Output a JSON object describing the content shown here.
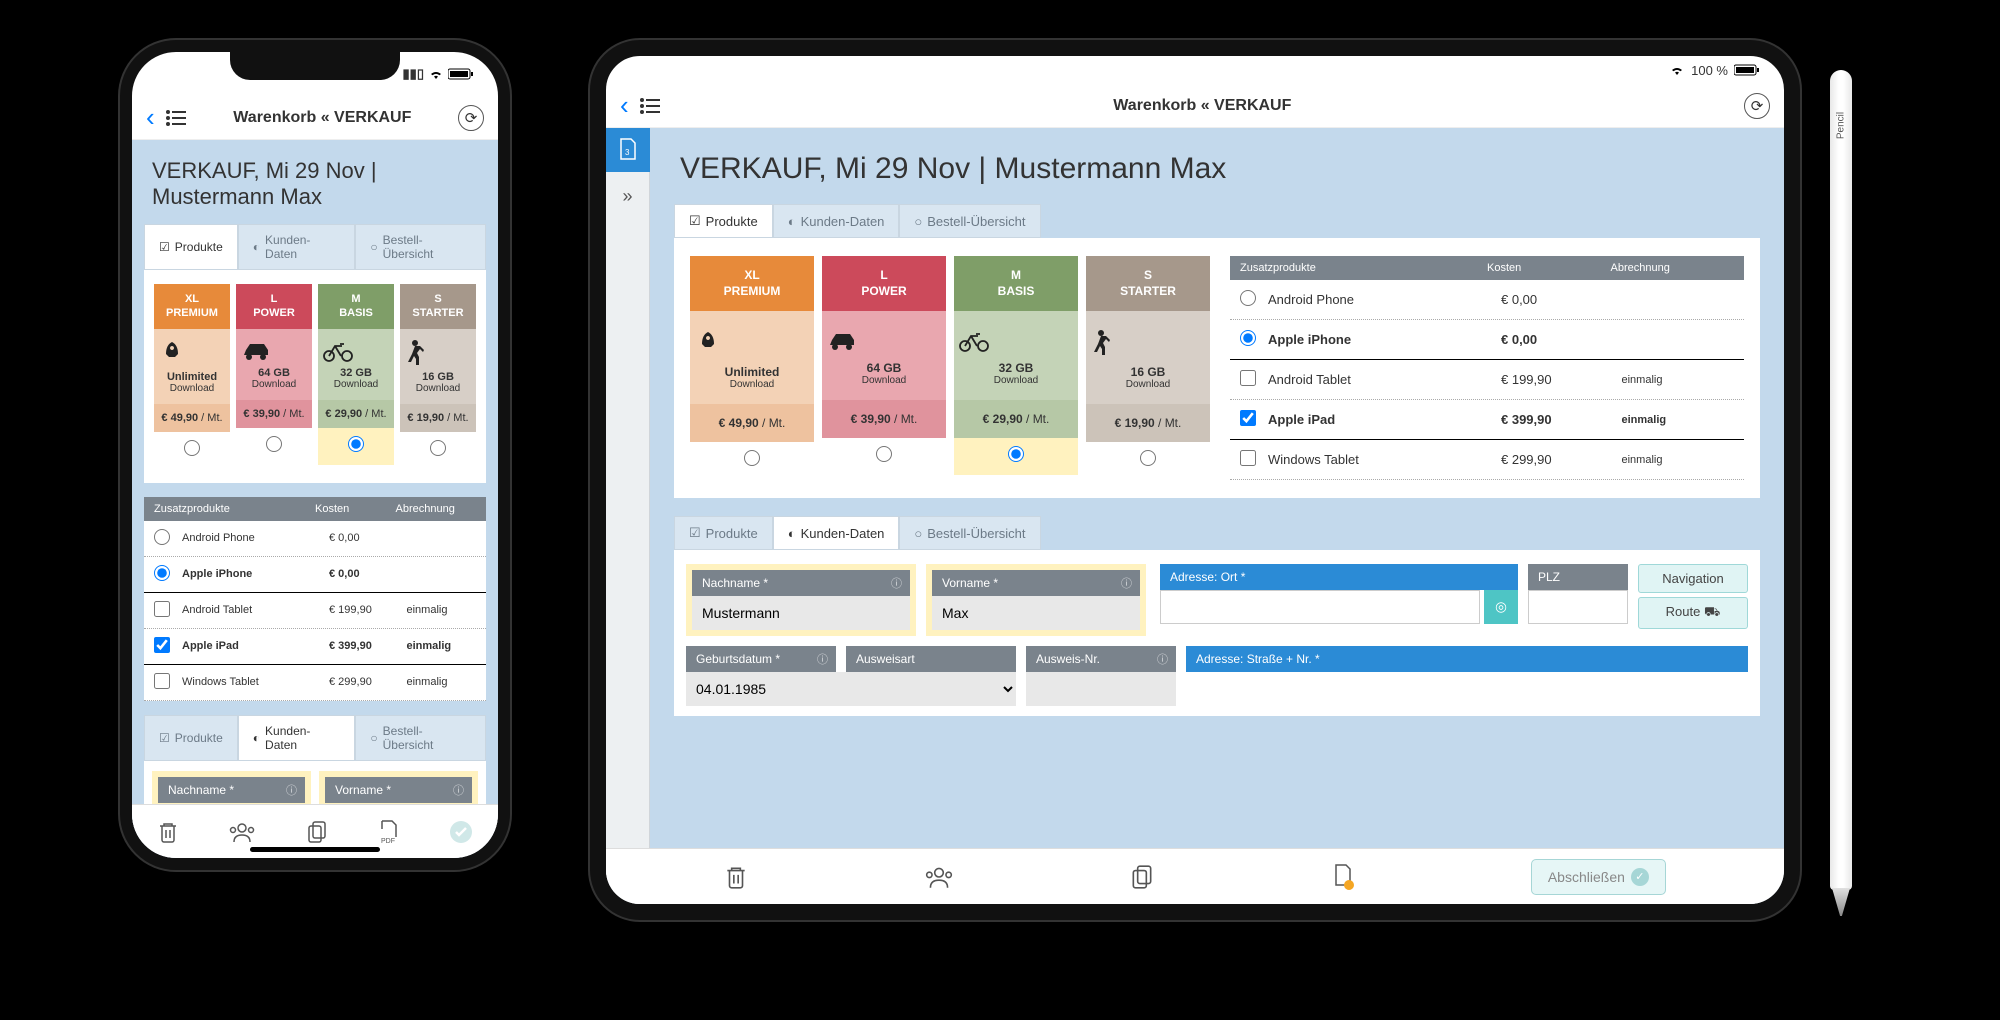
{
  "status": {
    "battery_ipad": "100 %"
  },
  "topbar": {
    "title_phone": "Warenkorb « VERKAUF",
    "title_ipad": "Warenkorb « VERKAUF"
  },
  "page": {
    "heading_strong": "VERKAUF,",
    "heading_rest": " Mi 29 Nov | Mustermann Max"
  },
  "tabs": {
    "products": "Produkte",
    "customer": "Kunden-Daten",
    "summary": "Bestell-Übersicht"
  },
  "plans": [
    {
      "tier_top": "XL",
      "tier_bot": "PREMIUM",
      "amount": "Unlimited",
      "sub": "Download",
      "price": "€ 49,90",
      "per": " / Mt.",
      "colors": {
        "head": "#e78a3a",
        "body": "#f3d2b6",
        "price": "#eec29f"
      },
      "icon": "rocket"
    },
    {
      "tier_top": "L",
      "tier_bot": "POWER",
      "amount": "64 GB",
      "sub": "Download",
      "price": "€ 39,90",
      "per": " / Mt.",
      "colors": {
        "head": "#cc4a5b",
        "body": "#e9a7af",
        "price": "#e0939d"
      },
      "icon": "car"
    },
    {
      "tier_top": "M",
      "tier_bot": "BASIS",
      "amount": "32 GB",
      "sub": "Download",
      "price": "€ 29,90",
      "per": " / Mt.",
      "colors": {
        "head": "#7f9e68",
        "body": "#c4d3b7",
        "price": "#b6c8a6"
      },
      "icon": "bike",
      "selected": true
    },
    {
      "tier_top": "S",
      "tier_bot": "STARTER",
      "amount": "16 GB",
      "sub": "Download",
      "price": "€ 19,90",
      "per": " / Mt.",
      "colors": {
        "head": "#a6988b",
        "body": "#d7cfc7",
        "price": "#ccc3b9"
      },
      "icon": "walk"
    }
  ],
  "addons": {
    "headers": {
      "product": "Zusatzprodukte",
      "cost": "Kosten",
      "billing": "Abrechnung"
    },
    "rows": [
      {
        "name": "Android Phone",
        "cost": "€ 0,00",
        "billing": "",
        "type": "radio",
        "selected": false
      },
      {
        "name": "Apple iPhone",
        "cost": "€ 0,00",
        "billing": "",
        "type": "radio",
        "selected": true
      },
      {
        "name": "Android Tablet",
        "cost": "€ 199,90",
        "billing": "einmalig",
        "type": "checkbox",
        "selected": false
      },
      {
        "name": "Apple iPad",
        "cost": "€ 399,90",
        "billing": "einmalig",
        "type": "checkbox",
        "selected": true
      },
      {
        "name": "Windows Tablet",
        "cost": "€ 299,90",
        "billing": "einmalig",
        "type": "checkbox",
        "selected": false
      }
    ]
  },
  "form": {
    "lastname_label": "Nachname *",
    "lastname_value": "Mustermann",
    "firstname_label": "Vorname *",
    "firstname_value": "Max",
    "dob_label": "Geburtsdatum *",
    "dob_value": "04.01.1985",
    "idtype_label": "Ausweisart",
    "idnum_label": "Ausweis-Nr.",
    "city_label": "Adresse: Ort *",
    "zip_label": "PLZ",
    "street_label": "Adresse: Straße + Nr. *",
    "nav_label": "Navigation",
    "route_label": "Route"
  },
  "bottombar": {
    "done": "Abschließen"
  },
  "pencil_label": "Pencil"
}
